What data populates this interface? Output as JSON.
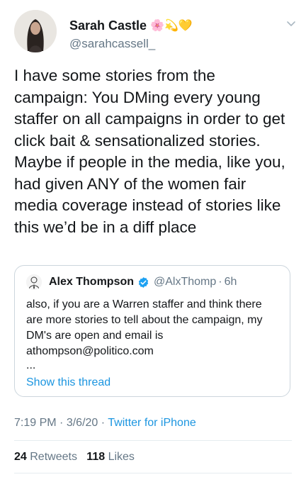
{
  "author": {
    "display_name": "Sarah Castle",
    "name_emojis": "🌸💫💛",
    "handle": "@sarahcassell_"
  },
  "tweet": {
    "text": "I have some stories from the\ncampaign: You DMing every young\nstaffer on all campaigns in order to get\nclick bait & sensationalized stories.\nMaybe if people in the media, like you,\nhad given ANY of the women fair\nmedia coverage instead of stories like\nthis we’d be in a diff place",
    "time": "7:19 PM",
    "date": "3/6/20",
    "source": "Twitter for iPhone",
    "separator": "·"
  },
  "quoted": {
    "display_name": "Alex Thompson",
    "handle": "@AlxThomp",
    "time": "6h",
    "separator": "·",
    "text": "also, if you are a Warren staffer and think there\nare more stories to tell about the campaign, my\nDM's are open and email is\nathompson@politico.com",
    "ellipsis": "...",
    "show_thread": "Show this thread"
  },
  "stats": {
    "retweets_count": "24",
    "retweets_label": "Retweets",
    "likes_count": "118",
    "likes_label": "Likes"
  },
  "colors": {
    "link": "#1b95e0",
    "secondary_text": "#657786",
    "border": "#ccd6dd",
    "verified": "#1da1f2"
  }
}
